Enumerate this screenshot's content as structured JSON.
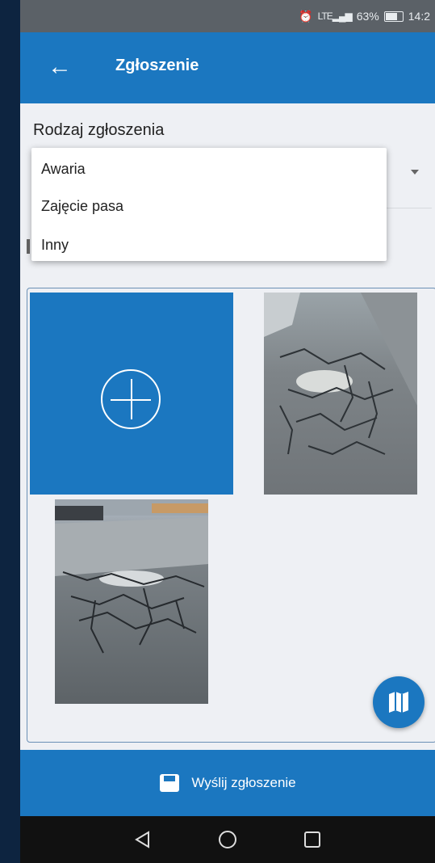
{
  "status_bar": {
    "alarm_icon": "alarm-clock-icon",
    "signal_text": "LTE",
    "battery_percent_text": "63%",
    "time": "14:2"
  },
  "app_bar": {
    "back_icon": "arrow-left-icon",
    "title": "Zgłoszenie"
  },
  "form": {
    "type_label": "Rodzaj zgłoszenia",
    "dropdown_options": [
      "Awaria",
      "Zajęcie pasa",
      "Inny"
    ]
  },
  "photos": {
    "add_icon": "plus-circle-icon",
    "items": [
      "pothole-photo-1",
      "pothole-photo-2"
    ]
  },
  "fab": {
    "icon": "map-icon"
  },
  "bottom_bar": {
    "icon": "floppy-disk-icon",
    "submit_label": "Wyślij zgłoszenie"
  },
  "nav": {
    "back": "triangle-back-icon",
    "home": "circle-home-icon",
    "recents": "square-recents-icon"
  },
  "colors": {
    "primary": "#1b77c0",
    "background": "#eef0f4",
    "status_bar": "#5b6167",
    "nav_bar": "#111111"
  }
}
